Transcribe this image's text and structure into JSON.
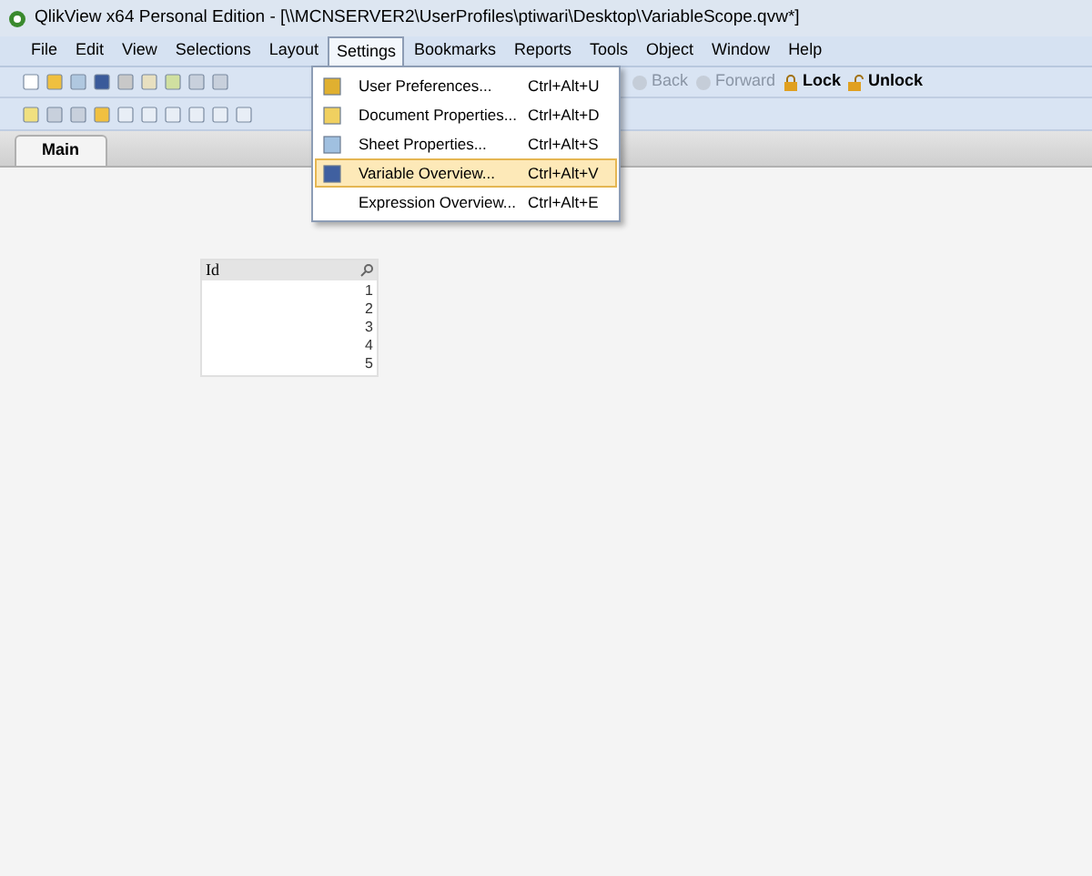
{
  "window": {
    "title": "QlikView x64 Personal Edition - [\\\\MCNSERVER2\\UserProfiles\\ptiwari\\Desktop\\VariableScope.qvw*]"
  },
  "menu_bar": [
    {
      "label": "File",
      "selected": false
    },
    {
      "label": "Edit",
      "selected": false
    },
    {
      "label": "View",
      "selected": false
    },
    {
      "label": "Selections",
      "selected": false
    },
    {
      "label": "Layout",
      "selected": false
    },
    {
      "label": "Settings",
      "selected": true
    },
    {
      "label": "Bookmarks",
      "selected": false
    },
    {
      "label": "Reports",
      "selected": false
    },
    {
      "label": "Tools",
      "selected": false
    },
    {
      "label": "Object",
      "selected": false
    },
    {
      "label": "Window",
      "selected": false
    },
    {
      "label": "Help",
      "selected": false
    }
  ],
  "toolbar": {
    "back": "Back",
    "forward": "Forward",
    "lock": "Lock",
    "unlock": "Unlock"
  },
  "settings_menu": [
    {
      "label": "User Preferences...",
      "shortcut": "Ctrl+Alt+U",
      "selected": false
    },
    {
      "label": "Document Properties...",
      "shortcut": "Ctrl+Alt+D",
      "selected": false
    },
    {
      "label": "Sheet Properties...",
      "shortcut": "Ctrl+Alt+S",
      "selected": false
    },
    {
      "label": "Variable Overview...",
      "shortcut": "Ctrl+Alt+V",
      "selected": true
    },
    {
      "label": "Expression Overview...",
      "shortcut": "Ctrl+Alt+E",
      "selected": false
    }
  ],
  "sheet_tabs": [
    {
      "label": "Main",
      "selected": true
    }
  ],
  "list_box": {
    "title": "Id",
    "values": [
      "1",
      "2",
      "3",
      "4",
      "5"
    ]
  }
}
